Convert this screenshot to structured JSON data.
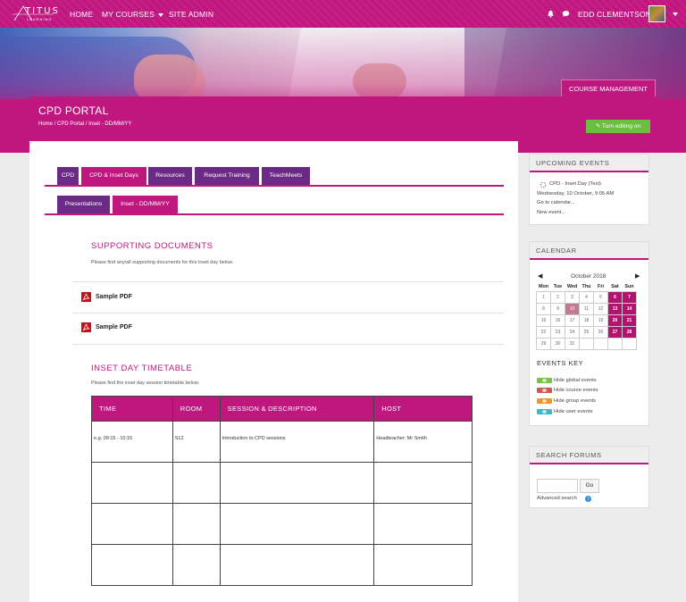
{
  "logo": {
    "top": "TITUS",
    "bottom": "LEARNING"
  },
  "nav": {
    "home": "HOME",
    "my_courses": "MY COURSES",
    "site_admin": "SITE ADMIN",
    "user_name": "EDD CLEMENTSON"
  },
  "header": {
    "course_management": "COURSE MANAGEMENT",
    "title": "CPD PORTAL",
    "breadcrumb": [
      "Home",
      "CPD Portal",
      "Inset - DD/MM/YY"
    ],
    "breadcrumb_sep": "/",
    "edit_button": "Turn editing on"
  },
  "tabs": {
    "row1": [
      "CPD",
      "CPD & Inset Days",
      "Resources",
      "Request Training",
      "TeachMeets"
    ],
    "row2": [
      "Presentations",
      "Inset - DD/MM/YY"
    ]
  },
  "supporting": {
    "title": "SUPPORTING DOCUMENTS",
    "desc": "Please find any/all supporting documents for this Inset day below.",
    "files": [
      "Sample PDF",
      "Sample PDF"
    ]
  },
  "timetable": {
    "title": "INSET DAY TIMETABLE",
    "desc": "Please find the inset day session timetable below.",
    "headers": [
      "TIME",
      "ROOM",
      "SESSION & DESCRIPTION",
      "HOST"
    ],
    "rows": [
      [
        "e.g. 09:15 - 10:15",
        "S12",
        "Introduction to CPD sessions",
        "Headteacher: Mr Smith"
      ],
      [
        "",
        "",
        "",
        ""
      ],
      [
        "",
        "",
        "",
        ""
      ],
      [
        "",
        "",
        "",
        ""
      ]
    ]
  },
  "upcoming": {
    "title": "UPCOMING EVENTS",
    "event_name": "CPD - Inset Day (Test)",
    "event_date": "Wednesday, 10 October, 9:05 AM",
    "go_calendar": "Go to calendar...",
    "new_event": "New event..."
  },
  "calendar": {
    "title": "CALENDAR",
    "month": "October 2018",
    "days": [
      "Mon",
      "Tue",
      "Wed",
      "Thu",
      "Fri",
      "Sat",
      "Sun"
    ],
    "weeks": [
      [
        "1",
        "2",
        "3",
        "4",
        "5",
        "6",
        "7"
      ],
      [
        "8",
        "9",
        "10",
        "11",
        "12",
        "13",
        "14"
      ],
      [
        "15",
        "16",
        "17",
        "18",
        "19",
        "20",
        "21"
      ],
      [
        "22",
        "23",
        "24",
        "25",
        "26",
        "27",
        "28"
      ],
      [
        "29",
        "30",
        "31",
        "",
        "",
        "",
        ""
      ]
    ],
    "events_key_title": "EVENTS KEY",
    "key": [
      {
        "label": "Hide global events",
        "color": "#7bc142"
      },
      {
        "label": "Hide course events",
        "color": "#c95a5a"
      },
      {
        "label": "Hide group events",
        "color": "#f0932b"
      },
      {
        "label": "Hide user events",
        "color": "#3fb6c7"
      }
    ]
  },
  "search_forums": {
    "title": "SEARCH FORUMS",
    "go": "Go",
    "advanced": "Advanced search"
  },
  "colors": {
    "brand": "#c0177f",
    "purple": "#6b2a85",
    "green": "#6abf3f"
  }
}
